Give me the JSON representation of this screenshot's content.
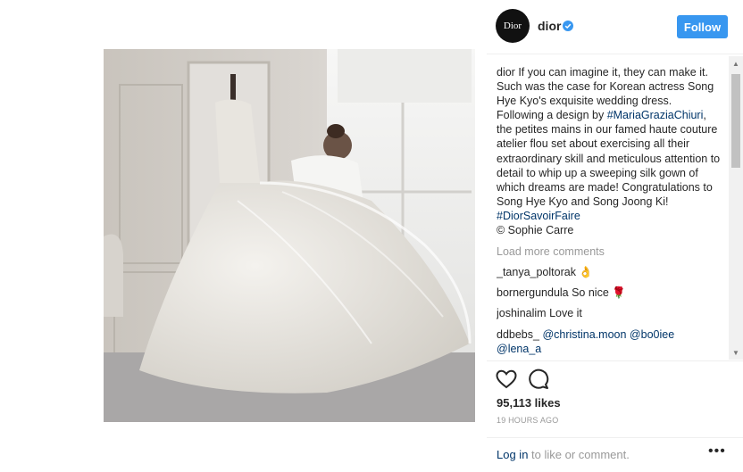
{
  "post": {
    "photo_credit": "© Sophie Carre"
  },
  "header": {
    "avatar_text": "Dior",
    "username": "dior",
    "follow_label": "Follow"
  },
  "caption": {
    "username": "dior",
    "text_1": " If you can imagine it, they can make it. Such was the case for Korean actress Song Hye Kyo's exquisite wedding dress. Following a design by ",
    "mention": "#MariaGraziaChiuri",
    "text_2": ", the petites mains in our famed haute couture atelier flou set about exercising all their extraordinary skill and meticulous attention to detail to whip up a sweeping silk gown of which dreams are made! Congratulations to Song Hye Kyo and Song Joong Ki! ",
    "hashtag": "#DiorSavoirFaire",
    "credit": "© Sophie Carre"
  },
  "load_more": "Load more comments",
  "comments": [
    {
      "user": "_tanya_poltorak",
      "text": " 👌"
    },
    {
      "user": "bornergundula",
      "text": " So nice 🌹"
    },
    {
      "user": "joshinalim",
      "text": " Love it"
    },
    {
      "user": "ddbebs_",
      "text": " ",
      "mentions": [
        "@christina.moon",
        "@bo0iee",
        "@lena_a"
      ]
    }
  ],
  "likes": "95,113 likes",
  "timestamp": "19 HOURS AGO",
  "login": {
    "link": "Log in",
    "suffix": " to like or comment."
  },
  "icons": {
    "like": "heart-icon",
    "comment": "comment-icon",
    "more": "more-dots-icon",
    "verified": "verified-badge-icon"
  },
  "colors": {
    "follow_bg": "#3897f0",
    "link": "#003569",
    "muted": "#999999",
    "verified": "#3897f0"
  }
}
